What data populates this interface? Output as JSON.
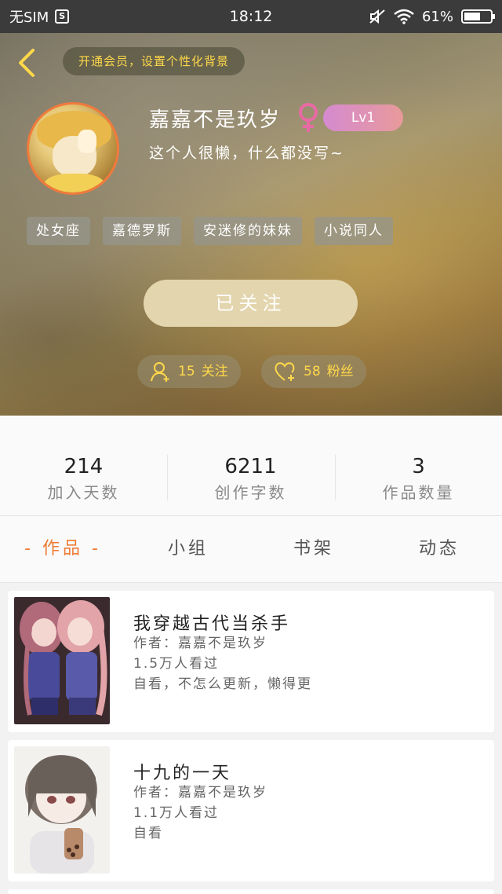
{
  "status_bar": {
    "carrier": "无SIM",
    "s_icon": "S",
    "time": "18:12",
    "battery": "61%",
    "battery_level": 0.61
  },
  "header": {
    "vip_text": "开通会员，设置个性化背景",
    "username": "嘉嘉不是玖岁",
    "level": "Lv1",
    "bio": "这个人很懒，什么都没写~",
    "tags": [
      "处女座",
      "嘉德罗斯",
      "安迷修的妹妹",
      "小说同人"
    ],
    "follow_button": "已关注",
    "following": {
      "count": "15",
      "label": "关注"
    },
    "fans": {
      "count": "58",
      "label": "粉丝"
    }
  },
  "stats": [
    {
      "value": "214",
      "label": "加入天数"
    },
    {
      "value": "6211",
      "label": "创作字数"
    },
    {
      "value": "3",
      "label": "作品数量"
    }
  ],
  "tabs": [
    "- 作品 -",
    "小组",
    "书架",
    "动态"
  ],
  "works": [
    {
      "title": "我穿越古代当杀手",
      "author": "作者：嘉嘉不是玖岁",
      "views": "1.5万人看过",
      "desc": "自看，不怎么更新，懒得更"
    },
    {
      "title": "十九的一天",
      "author": "作者：嘉嘉不是玖岁",
      "views": "1.1万人看过",
      "desc": "自看"
    }
  ],
  "colors": {
    "accent": "#ee7b35",
    "gold": "#ffd84a",
    "avatar_border": "#f07a3c"
  }
}
